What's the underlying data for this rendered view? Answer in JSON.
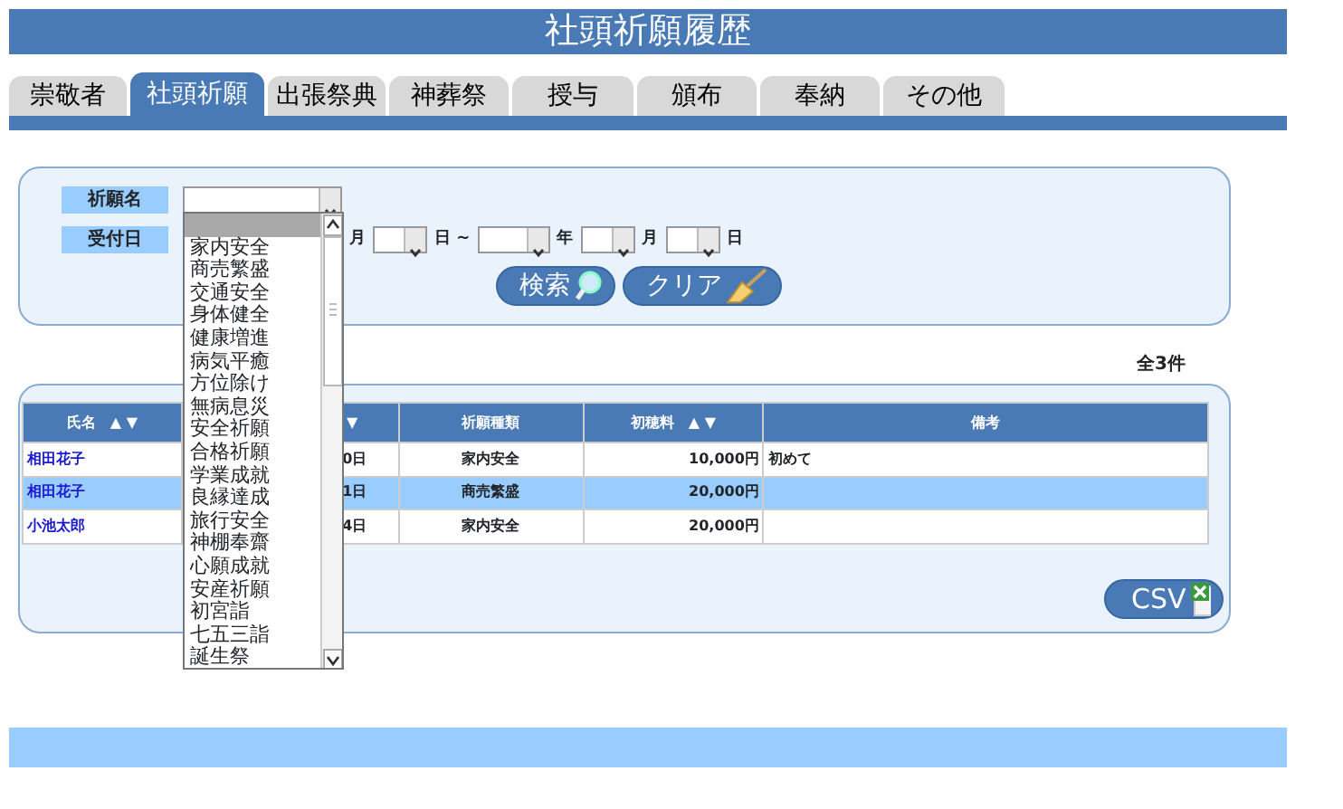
{
  "title": "社頭祈願履歴",
  "tabs": [
    {
      "label": "崇敬者",
      "selected": false
    },
    {
      "label": "社頭祈願",
      "selected": true
    },
    {
      "label": "出張祭典",
      "selected": false
    },
    {
      "label": "神葬祭",
      "selected": false
    },
    {
      "label": "授与",
      "selected": false
    },
    {
      "label": "頒布",
      "selected": false
    },
    {
      "label": "奉納",
      "selected": false
    },
    {
      "label": "その他",
      "selected": false
    }
  ],
  "search": {
    "prayer_name": {
      "label": "祈願名",
      "expanded": true,
      "options": [
        {
          "selected": true
        },
        {
          "label": "家内安全",
          "selected": false
        },
        {
          "label": "商売繁盛",
          "selected": false
        },
        {
          "label": "交通安全",
          "selected": false
        },
        {
          "label": "身体健全",
          "selected": false
        },
        {
          "label": "健康増進",
          "selected": false
        },
        {
          "label": "病気平癒",
          "selected": false
        },
        {
          "label": "方位除け",
          "selected": false
        },
        {
          "label": "無病息災",
          "selected": false
        },
        {
          "label": "安全祈願",
          "selected": false
        },
        {
          "label": "合格祈願",
          "selected": false
        },
        {
          "label": "学業成就",
          "selected": false
        },
        {
          "label": "良縁達成",
          "selected": false
        },
        {
          "label": "旅行安全",
          "selected": false
        },
        {
          "label": "神棚奉齋",
          "selected": false
        },
        {
          "label": "心願成就",
          "selected": false
        },
        {
          "label": "安産祈願",
          "selected": false
        },
        {
          "label": "初宮詣",
          "selected": false
        },
        {
          "label": "七五三詣",
          "selected": false
        },
        {
          "label": "誕生祭",
          "selected": false
        }
      ]
    },
    "received_date": {
      "label": "受付日",
      "parts": [
        {
          "kind": "text",
          "text": "月"
        },
        {
          "kind": "select"
        },
        {
          "kind": "text",
          "text": "日 ~"
        },
        {
          "kind": "select"
        },
        {
          "kind": "text",
          "text": "年"
        },
        {
          "kind": "select"
        },
        {
          "kind": "text",
          "text": "月"
        },
        {
          "kind": "select"
        },
        {
          "kind": "text",
          "text": "日"
        }
      ]
    },
    "buttons": [
      {
        "label": "検索"
      },
      {
        "label": "クリア"
      }
    ]
  },
  "results": {
    "count": "全3件",
    "columns": [
      {
        "label": "氏名",
        "sort": "▲ ▼"
      },
      {
        "sort": "▼"
      },
      {
        "label": "祈願種類"
      },
      {
        "label": "初穂料",
        "sort": "▲ ▼"
      },
      {
        "label": "備考"
      }
    ],
    "rows": [
      {
        "selected": false,
        "cells": [
          "相田花子",
          "0日",
          "家内安全",
          "10,000円",
          "初めて"
        ]
      },
      {
        "selected": true,
        "cells": [
          "相田花子",
          "1日",
          "商売繁盛",
          "20,000円",
          ""
        ]
      },
      {
        "selected": false,
        "cells": [
          "小池太郎",
          "4日",
          "家内安全",
          "20,000円",
          ""
        ]
      }
    ],
    "csv_button": "CSV"
  }
}
